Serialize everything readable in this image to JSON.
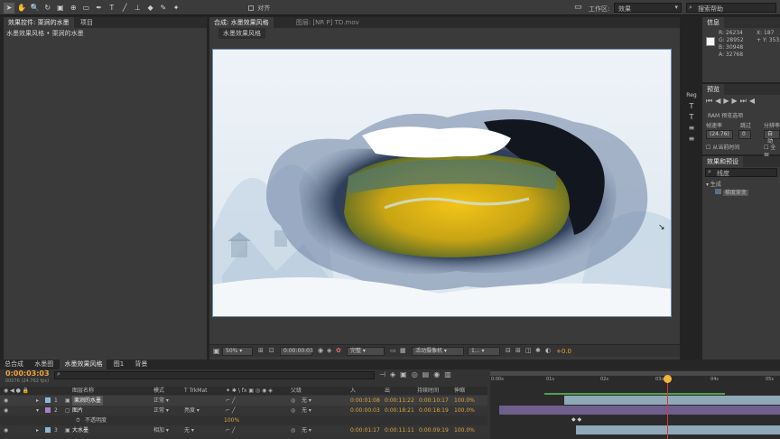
{
  "toolbar": {
    "snap_label": "对齐",
    "workspace_label": "工作区:",
    "workspace_value": "效果",
    "search_placeholder": "搜索帮助"
  },
  "left_panel": {
    "tab_label": "效果控件: 栗涧的水墨",
    "tab2_label": "项目",
    "breadcrumb": "水墨效果风格 • 栗涧的水墨"
  },
  "viewer": {
    "tab_label": "合成: 水墨效果风格",
    "tab2_label": "图层: [NR P] TD.mov",
    "sub_tab": "水墨效果风格",
    "zoom": "50%",
    "timecode": "0:00:00:03",
    "resolution": "完整",
    "camera": "活动摄像机",
    "views": "1...",
    "exposure": "+0.0"
  },
  "info_panel": {
    "tab_label": "信息",
    "r": "R: 26234",
    "g": "G: 28952",
    "b": "B: 30948",
    "a": "A: 32768",
    "x": "X: 187",
    "y": "+ Y: 353"
  },
  "preview_panel": {
    "tab_label": "预览",
    "ram_label": "RAM 预览选项",
    "frame_rate_label": "帧速率",
    "skip_label": "跳过",
    "resolution_label": "分辨率",
    "frame_rate_value": "(24.76)",
    "skip_value": "0",
    "resolution_value": "自动",
    "from_current": "从当前时间",
    "fullscreen": "全屏",
    "reg_label": "Reg"
  },
  "effects_panel": {
    "tab_label": "效果和预设",
    "search_value": "线度",
    "category": "生成",
    "item": "梯度渐变"
  },
  "timeline": {
    "tabs": [
      "总合成",
      "水墨图",
      "水墨效果风格",
      "图1",
      "背景"
    ],
    "current_time": "0:00:03:03",
    "fps_note": "00076 (24.762 fps)",
    "columns": {
      "layer_name": "图层名称",
      "mode": "模式",
      "trkmat": "T  TrkMat",
      "parent": "父级",
      "in": "入",
      "out": "出",
      "duration": "持续时间",
      "stretch": "伸缩"
    },
    "ruler_labels": [
      "0:00s",
      "01s",
      "02s",
      "03s",
      "04s",
      "05s"
    ],
    "layers": [
      {
        "num": "1",
        "name": "栗涧的水墨",
        "mode": "正常",
        "trk": "",
        "parent": "无",
        "in": "0:00:01:08",
        "out": "0:00:11:22",
        "dur": "0:00:10:17",
        "stretch": "100.0%"
      },
      {
        "num": "2",
        "name": "图片",
        "mode": "正常",
        "trk": "亮度",
        "parent": "无",
        "in": "0:00:00:03",
        "out": "0:00:18:21",
        "dur": "0:00:18:19",
        "stretch": "100.0%"
      },
      {
        "num": "",
        "name": "不透明度",
        "mode": "",
        "trk": "",
        "parent": "",
        "in": "",
        "out": "",
        "dur": "",
        "stretch": "100%"
      },
      {
        "num": "3",
        "name": "大水墨",
        "mode": "相加",
        "trk": "无",
        "parent": "无",
        "in": "0:00:01:17",
        "out": "0:00:11:11",
        "dur": "0:00:09:19",
        "stretch": "100.0%"
      }
    ]
  }
}
